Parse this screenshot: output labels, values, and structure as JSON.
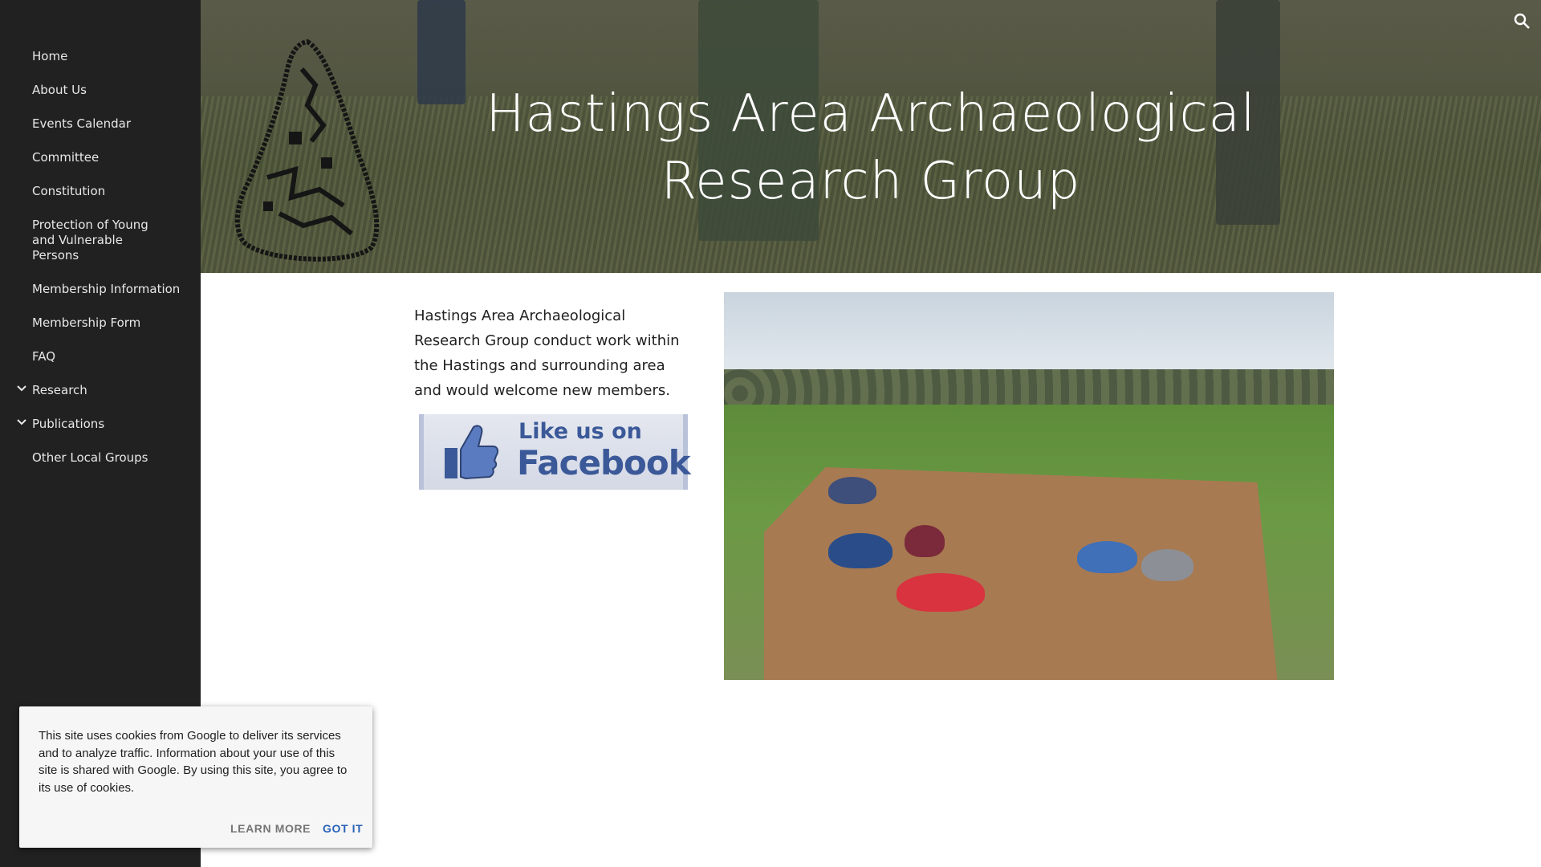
{
  "sidebar": {
    "items": [
      {
        "label": "Home",
        "expandable": false
      },
      {
        "label": "About Us",
        "expandable": false
      },
      {
        "label": "Events Calendar",
        "expandable": false
      },
      {
        "label": "Committee",
        "expandable": false
      },
      {
        "label": "Constitution",
        "expandable": false
      },
      {
        "label": "Protection of Young and Vulnerable Persons",
        "expandable": false
      },
      {
        "label": "Membership Information",
        "expandable": false
      },
      {
        "label": "Membership Form",
        "expandable": false
      },
      {
        "label": "FAQ",
        "expandable": false
      },
      {
        "label": "Research",
        "expandable": true
      },
      {
        "label": "Publications",
        "expandable": true
      },
      {
        "label": "Other Local Groups",
        "expandable": false
      }
    ],
    "background_color": "#212121",
    "chevron_icon": "chevron-down-icon"
  },
  "header": {
    "title_line1": "Hastings Area Archaeological",
    "title_line2": "Research Group",
    "search_icon": "search-icon"
  },
  "main": {
    "intro_text": "Hastings Area Archaeological Research Group conduct work within the Hastings and surrounding area and would welcome new members.",
    "facebook_badge": {
      "line1": "Like us on",
      "line2": "Facebook",
      "icon": "thumbs-up-icon",
      "color": "#3b5998"
    }
  },
  "cookie_banner": {
    "text": "This site uses cookies from Google to deliver its services and to analyze traffic. Information about your use of this site is shared with Google. By using this site, you agree to its use of cookies.",
    "learn_more_label": "LEARN MORE",
    "got_it_label": "GOT IT",
    "accent_color": "#2962b9"
  }
}
